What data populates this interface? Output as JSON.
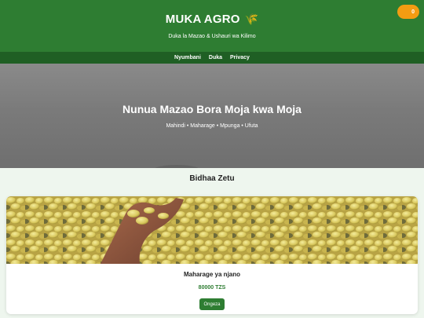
{
  "header": {
    "brand": "MUKA AGRO",
    "brand_icon": "🌾",
    "tagline": "Duka la Mazao & Ushauri wa Kilimo",
    "cart_count": "0"
  },
  "nav": {
    "items": [
      {
        "label": "Nyumbani"
      },
      {
        "label": "Duka"
      },
      {
        "label": "Privacy"
      }
    ]
  },
  "hero": {
    "title": "Nunua Mazao Bora Moja kwa Moja",
    "subtitle": "Mahindi • Maharage • Mpunga • Ufuta"
  },
  "products": {
    "title": "Bidhaa Zetu",
    "items": [
      {
        "name": "Maharage ya njano",
        "price": "80000 TZS",
        "button": "Ongeza",
        "image": "yellow-beans-photo"
      }
    ]
  },
  "colors": {
    "primary": "#2e7d32",
    "nav": "#1f5f24",
    "cart_badge": "#f39c12",
    "page_bg": "#eef6ee"
  }
}
